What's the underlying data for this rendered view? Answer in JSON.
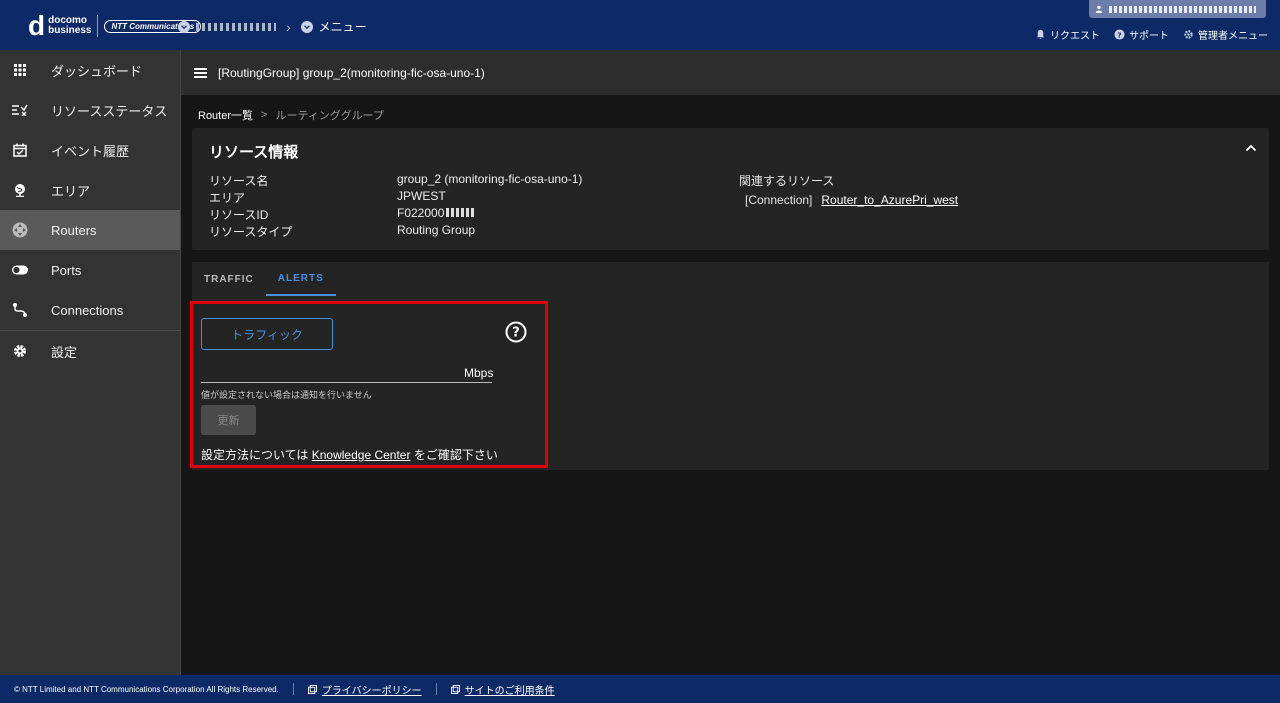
{
  "header": {
    "logo": {
      "brand_top": "docomo",
      "brand_bottom": "business",
      "partner": "NTT Communications"
    },
    "menu_label": "メニュー",
    "links": [
      {
        "label": "リクエスト",
        "icon": "bell-icon"
      },
      {
        "label": "サポート",
        "icon": "help-circle-icon"
      },
      {
        "label": "管理者メニュー",
        "icon": "gear-icon"
      }
    ]
  },
  "sidebar": {
    "items": [
      {
        "label": "ダッシュボード",
        "icon": "grid-icon"
      },
      {
        "label": "リソースステータス",
        "icon": "list-check-icon"
      },
      {
        "label": "イベント履歴",
        "icon": "calendar-check-icon"
      },
      {
        "label": "エリア",
        "icon": "globe-icon"
      },
      {
        "label": "Routers",
        "icon": "router-icon",
        "active": true
      },
      {
        "label": "Ports",
        "icon": "ports-icon"
      },
      {
        "label": "Connections",
        "icon": "connection-icon"
      },
      {
        "label": "設定",
        "icon": "gear-icon"
      }
    ]
  },
  "page": {
    "title": "[RoutingGroup] group_2(monitoring-fic-osa-uno-1)",
    "breadcrumb": [
      "Router一覧",
      "ルーティンググループ"
    ],
    "breadcrumb_sep": ">"
  },
  "resource": {
    "title": "リソース情報",
    "rows": [
      {
        "label": "リソース名",
        "value": "group_2 (monitoring-fic-osa-uno-1)"
      },
      {
        "label": "エリア",
        "value": "JPWEST"
      },
      {
        "label": "リソースID",
        "value": "F022000"
      },
      {
        "label": "リソースタイプ",
        "value": "Routing Group"
      }
    ],
    "related_title": "関連するリソース",
    "related_type": "[Connection]",
    "related_link": "Router_to_AzurePri_west"
  },
  "tabs": [
    "TRAFFIC",
    "ALERTS"
  ],
  "alerts": {
    "traffic_button": "トラフィック",
    "unit": "Mbps",
    "hint": "値が設定されない場合は通知を行いません",
    "update_button": "更新",
    "note_prefix": "設定方法については ",
    "note_link": "Knowledge Center",
    "note_suffix": " をご確認下さい"
  },
  "footer": {
    "copyright": "© NTT Limited and NTT Communications Corporation All Rights Reserved.",
    "privacy": "プライバシーポリシー",
    "terms": "サイトのご利用条件"
  },
  "colors": {
    "navy": "#0e2a66",
    "accent_blue": "#4a90e2",
    "highlight_red": "#e00000"
  }
}
